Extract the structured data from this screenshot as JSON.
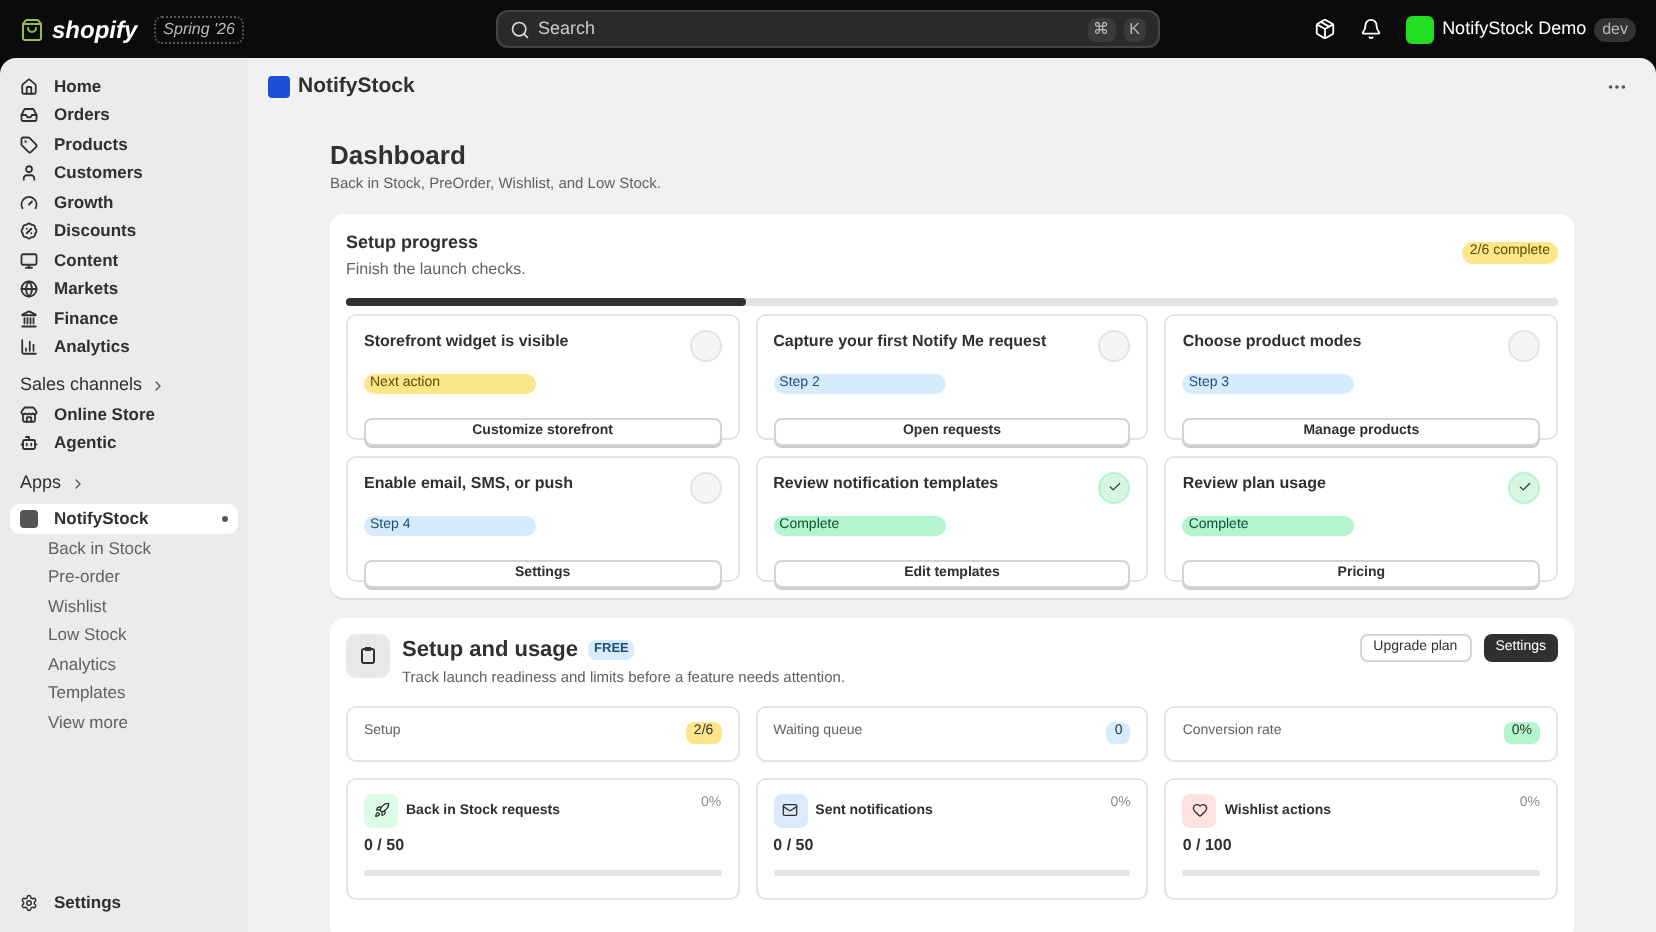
{
  "topbar": {
    "brand": "shopify",
    "edition": "Spring '26",
    "search": {
      "placeholder": "Search"
    },
    "shortcut": [
      "⌘",
      "K"
    ],
    "store": "NotifyStock Demo",
    "store_badge": "dev"
  },
  "sidebar": {
    "items": [
      {
        "label": "Home"
      },
      {
        "label": "Orders"
      },
      {
        "label": "Products"
      },
      {
        "label": "Customers"
      },
      {
        "label": "Growth"
      },
      {
        "label": "Discounts"
      },
      {
        "label": "Content"
      },
      {
        "label": "Markets"
      },
      {
        "label": "Finance"
      },
      {
        "label": "Analytics"
      }
    ],
    "sales_channels": {
      "heading": "Sales channels",
      "items": [
        {
          "label": "Online Store"
        },
        {
          "label": "Agentic"
        }
      ]
    },
    "apps": {
      "heading": "Apps",
      "app": {
        "label": "NotifyStock",
        "selected": true,
        "children": [
          {
            "label": "Back in Stock"
          },
          {
            "label": "Pre-order"
          },
          {
            "label": "Wishlist"
          },
          {
            "label": "Low Stock"
          },
          {
            "label": "Analytics"
          },
          {
            "label": "Templates"
          },
          {
            "label": "View more"
          }
        ]
      }
    },
    "settings": "Settings"
  },
  "app_header": {
    "title": "NotifyStock"
  },
  "page": {
    "title": "Dashboard",
    "subtitle": "Back in Stock, PreOrder, Wishlist, and Low Stock."
  },
  "setup_progress": {
    "title": "Setup progress",
    "subtitle": "Finish the launch checks.",
    "badge": "2/6 complete",
    "level": 0.33,
    "tasks": [
      {
        "title": "Storefront widget is visible",
        "status": "Next action",
        "kind": "next",
        "done": false,
        "action": "Customize storefront"
      },
      {
        "title": "Capture your first Notify Me request",
        "status": "Step 2",
        "kind": "step",
        "done": false,
        "action": "Open requests"
      },
      {
        "title": "Choose product modes",
        "status": "Step 3",
        "kind": "step",
        "done": false,
        "action": "Manage products"
      },
      {
        "title": "Enable email, SMS, or push",
        "status": "Step 4",
        "kind": "step",
        "done": false,
        "action": "Settings"
      },
      {
        "title": "Review notification templates",
        "status": "Complete",
        "kind": "complete",
        "done": true,
        "action": "Edit templates"
      },
      {
        "title": "Review plan usage",
        "status": "Complete",
        "kind": "complete",
        "done": true,
        "action": "Pricing"
      }
    ]
  },
  "setup_usage": {
    "title": "Setup and usage",
    "plan": "FREE",
    "subtitle": "Track launch readiness and limits before a feature needs attention.",
    "buttons": [
      "Upgrade plan",
      "Settings"
    ],
    "stats": [
      {
        "label": "Setup",
        "value": "2/6",
        "color": "#fde68a"
      },
      {
        "label": "Waiting queue",
        "value": "0",
        "color": "#d6ecfc"
      },
      {
        "label": "Conversion rate",
        "value": "0%",
        "color": "#b4f5cf"
      }
    ],
    "usage": [
      {
        "label": "Back in Stock requests",
        "percent": "0%",
        "count": "0 / 50",
        "color": "#dcfce7"
      },
      {
        "label": "Sent notifications",
        "percent": "0%",
        "count": "0 / 50",
        "color": "#dbeafe"
      },
      {
        "label": "Wishlist actions",
        "percent": "0%",
        "count": "0 / 100",
        "color": "#fee2e2"
      }
    ]
  }
}
